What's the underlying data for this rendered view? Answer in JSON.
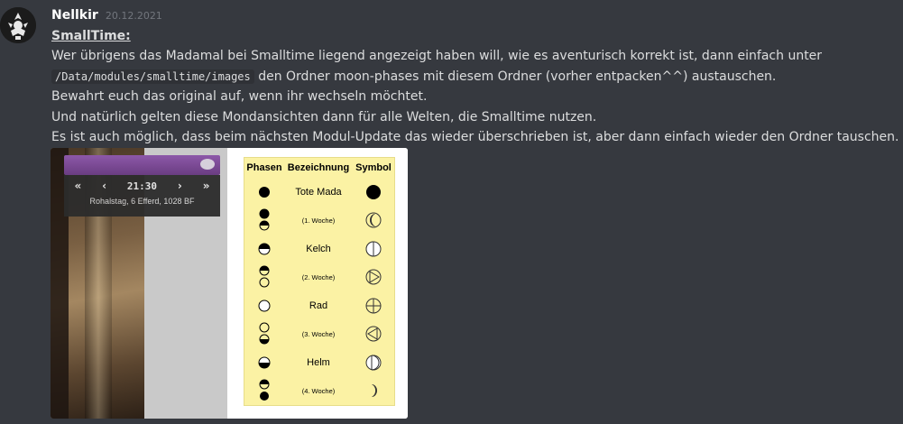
{
  "message": {
    "username": "Nellkir",
    "timestamp": "20.12.2021",
    "heading": "SmallTime:",
    "line1_pre": "Wer übrigens das Madamal bei Smalltime liegend angezeigt haben will, wie es aventurisch korrekt ist, dann einfach unter",
    "line2_code": "/Data/modules/smalltime/images",
    "line2_post": " den Ordner moon-phases mit diesem Ordner (vorher entpacken^^) austauschen.",
    "line3": "Bewahrt euch das original auf, wenn ihr wechseln möchtet.",
    "line4": "Und natürlich gelten diese Mondansichten dann für alle Welten, die Smalltime nutzen.",
    "line5": "Es ist auch möglich, dass beim nächsten Modul-Update das wieder überschrieben ist, aber dann einfach wieder den Ordner tauschen."
  },
  "attachment": {
    "smalltime": {
      "fast_back": "«",
      "back": "‹",
      "time": "21:30",
      "forward": "›",
      "fast_forward": "»",
      "date": "Rohalstag, 6 Efferd, 1028 BF"
    },
    "table": {
      "headers": [
        "Phasen",
        "Bezeichnung",
        "Symbol"
      ],
      "rows": [
        {
          "name": "Tote Mada"
        },
        {
          "name": "(1. Woche)"
        },
        {
          "name": "Kelch"
        },
        {
          "name": "(2. Woche)"
        },
        {
          "name": "Rad"
        },
        {
          "name": "(3. Woche)"
        },
        {
          "name": "Helm"
        },
        {
          "name": "(4. Woche)"
        }
      ]
    }
  },
  "colors": {
    "background": "#36393f",
    "username": "#ffffff",
    "timestamp": "#72767d",
    "text": "#dcddde",
    "table_bg": "#fbf2a4",
    "smalltime_bar": "#7a4896"
  }
}
